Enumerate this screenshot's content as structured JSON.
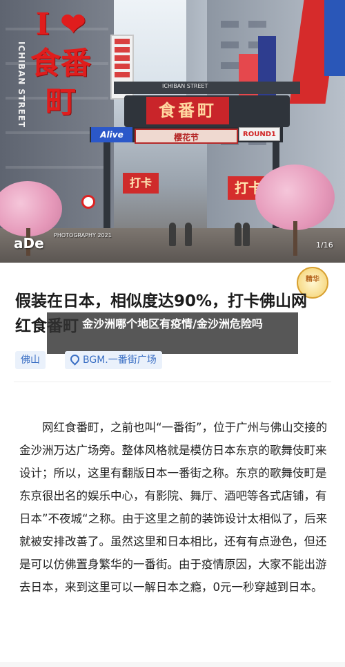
{
  "photo": {
    "heart_sign_text": "I ❤ 食番町",
    "side_sign_text": "ICHIBAN STREET",
    "gate_top_label": "ICHIBAN STREET",
    "gate_sign_text": "食番町",
    "alive_sign": "Alive",
    "sakura_sign": "樱花节",
    "round1_sign": "ROUND1",
    "street_sign_left": "打卡",
    "street_sign_right": "打卡",
    "watermark_ade": "aDe",
    "photo_credit": "PHOTOGRAPHY 2021",
    "counter": "1/16"
  },
  "badge": {
    "text": "精华"
  },
  "article": {
    "headline": "假装在日本，相似度达90%，打卡佛山网红食番町",
    "overlay_title": "金沙洲哪个地区有疫情/金沙洲危险吗",
    "tags": {
      "city": "佛山",
      "location": "BGM.一番街广场"
    },
    "body": "网红食番町，之前也叫“一番街”，位于广州与佛山交接的金沙洲万达广场旁。整体风格就是模仿日本东京的歌舞伎町来设计；所以，这里有翻版日本一番街之称。东京的歌舞伎町是东京很出名的娱乐中心，有影院、舞厅、酒吧等各式店铺，有日本”不夜城“之称。由于这里之前的装饰设计太相似了，后来就被安排改善了。虽然这里和日本相比，还有有点逊色，但还是可以仿佛置身繁华的一番街。由于疫情原因，大家不能出游去日本，来到这里可以一解日本之瘾，0元一秒穿越到日本。"
  },
  "colors": {
    "accent_red": "#e01d1d",
    "tag_blue": "#3a6fc4",
    "overlay_bg": "#323232"
  }
}
